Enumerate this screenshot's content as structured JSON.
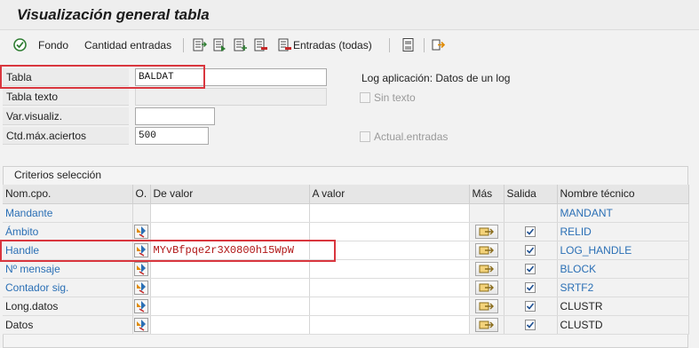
{
  "title": "Visualización general tabla",
  "toolbar": {
    "fondo": "Fondo",
    "cantidad": "Cantidad entradas",
    "entradas": "Entradas (todas)",
    "icons": [
      "execute-icon",
      "select-fields-icon",
      "fields-alt-icon",
      "add-fields-icon",
      "delete-fields-icon",
      "delete-entries-icon",
      "save-variant-icon",
      "export-icon"
    ]
  },
  "form": {
    "tabla_label": "Tabla",
    "tabla_value": "BALDAT",
    "tabla_texto_label": "Tabla texto",
    "var_label": "Var.visualiz.",
    "var_value": "",
    "ctd_label": "Ctd.máx.aciertos",
    "ctd_value": "500",
    "log_text": "Log aplicación: Datos de un log",
    "sin_texto": "Sin texto",
    "actual": "Actual.entradas"
  },
  "criteria": {
    "title": "Criterios selección",
    "headers": {
      "nom": "Nom.cpo.",
      "o": "O.",
      "de": "De valor",
      "a": "A valor",
      "mas": "Más",
      "salida": "Salida",
      "tecnico": "Nombre técnico"
    },
    "rows": [
      {
        "name": "Mandante",
        "value": "",
        "tech": "MANDANT",
        "link": true,
        "opt": false,
        "mas": false,
        "salida": false
      },
      {
        "name": "Ámbito",
        "value": "",
        "tech": "RELID",
        "link": true,
        "opt": true,
        "mas": true,
        "salida": true
      },
      {
        "name": "Handle",
        "value": "MYvBfpqe2r3X0800h15WpW",
        "tech": "LOG_HANDLE",
        "link": true,
        "opt": true,
        "mas": true,
        "salida": true
      },
      {
        "name": "Nº mensaje",
        "value": "",
        "tech": "BLOCK",
        "link": true,
        "opt": true,
        "mas": true,
        "salida": true
      },
      {
        "name": "Contador sig.",
        "value": "",
        "tech": "SRTF2",
        "link": true,
        "opt": true,
        "mas": true,
        "salida": true
      },
      {
        "name": "Long.datos",
        "value": "",
        "tech": "CLUSTR",
        "link": false,
        "opt": true,
        "mas": true,
        "salida": true
      },
      {
        "name": "Datos",
        "value": "",
        "tech": "CLUSTD",
        "link": false,
        "opt": true,
        "mas": true,
        "salida": true
      }
    ]
  }
}
